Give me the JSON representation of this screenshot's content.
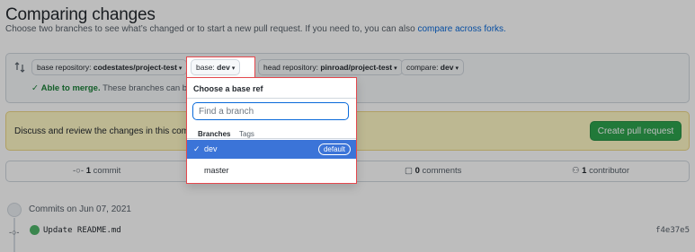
{
  "header": {
    "title": "Comparing changes",
    "subtitle": "Choose two branches to see what’s changed or to start a new pull request. If you need to, you can also ",
    "subtitle_link": "compare across forks."
  },
  "range": {
    "base_repo_label": "base repository: ",
    "base_repo_value": "codestates/project-test",
    "base_label": "base: ",
    "base_value": "dev",
    "head_repo_label": "head repository: ",
    "head_repo_value": "pinroad/project-test",
    "compare_label": "compare: ",
    "compare_value": "dev",
    "caret": "▾",
    "arrow": "←",
    "merge_ok": "Able to merge.",
    "merge_rest": " These branches can be"
  },
  "flash": {
    "text": "Discuss and review the changes in this compar",
    "button": "Create pull request"
  },
  "stats": {
    "commits_num": "1",
    "commits_label": " commit",
    "comments_num": "0",
    "comments_label": " comments",
    "contributors_num": "1",
    "contributors_label": " contributor"
  },
  "timeline": {
    "date_label": "Commits on Jun 07, 2021",
    "commit_message": "Update README.md",
    "sha": "f4e37e5"
  },
  "dropdown": {
    "title": "Choose a base ref",
    "placeholder": "Find a branch",
    "tab_branches": "Branches",
    "tab_tags": "Tags",
    "selected_branch": "dev",
    "default_badge": "default",
    "other_branch": "master",
    "check": "✓"
  },
  "colors": {
    "accent": "#0969da",
    "success": "#2da44e",
    "highlight_border": "#e5484d",
    "selected_row": "#3b74d8"
  }
}
